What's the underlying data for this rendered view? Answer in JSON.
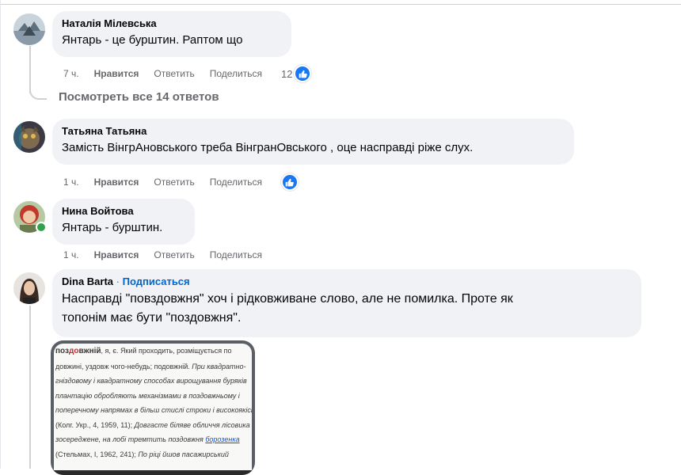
{
  "comments": [
    {
      "author": "Наталія Мілевська",
      "text": "Янтарь - це бурштин. Раптом що",
      "time": "7 ч.",
      "like_label": "Нравится",
      "reply_label": "Ответить",
      "share_label": "Поделиться",
      "reaction_count": "12"
    },
    {
      "author": "Татьяна Татьяна",
      "text": "Замість ВінгрАновського треба ВінгранОвського , оце насправді ріже слух.",
      "time": "1 ч.",
      "like_label": "Нравится",
      "reply_label": "Ответить",
      "share_label": "Поделиться"
    },
    {
      "author": "Нина Войтова",
      "text": "Янтарь - бурштин.",
      "time": "1 ч.",
      "like_label": "Нравится",
      "reply_label": "Ответить",
      "share_label": "Поделиться"
    },
    {
      "author": "Dina Barta",
      "separator": "·",
      "follow_label": "Подписаться",
      "text_line1": "Насправді \"повздовжня\" хоч і рідковживане слово, але не помилка. Проте як",
      "text_line2": "топонім має бути \"поздовжня\"."
    }
  ],
  "view_replies": "Посмотреть все 14 ответов",
  "attachment": {
    "head_word_a": "поз",
    "head_word_b": "до",
    "head_word_c": "вжній",
    "line1_rest": ", я, є. Який проходить, розміщується по",
    "line2": "довжині, уздовж чого-небудь; подовжній.",
    "line2_ital": " При квадратно-",
    "line3": "гніздовому і квадратному способах вирощування буряків",
    "line4": "плантацію обробляють механізмами в поздовжньому і",
    "line5": "поперечному напрямах в більш стислі строки і високоякісно",
    "line6a": "(Колг. Укр., 4, 1959, 11);",
    "line6b": " Довгасте біляве обличчя лісовика",
    "line7": "зосереджене, на лобі тремтить поздовжня ",
    "line7_link": "борозенка",
    "line8a": "(Стельмах, І, 1962, 241);",
    "line8b": " По ріці йшов пасажирський"
  },
  "colors": {
    "bubble": "#f0f2f5",
    "link": "#0064d1",
    "like": "#1877f2",
    "muted": "#65676b",
    "online": "#31a24c"
  }
}
